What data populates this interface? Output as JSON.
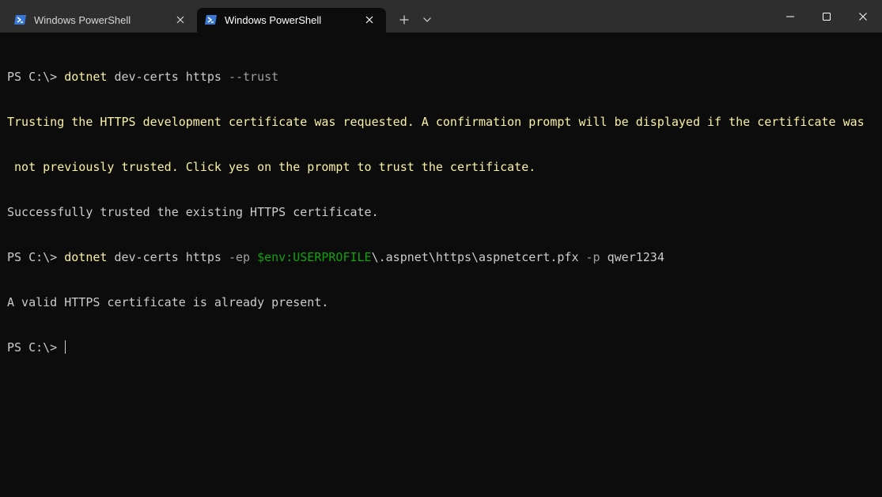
{
  "window": {
    "tabs": [
      {
        "title": "Windows PowerShell",
        "icon": "powershell-icon",
        "active": false
      },
      {
        "title": "Windows PowerShell",
        "icon": "powershell-icon",
        "active": true
      }
    ],
    "new_tab_label": "+",
    "dropdown_icon": "chevron-down-icon",
    "caption_buttons": [
      "minimize-icon",
      "maximize-icon",
      "close-icon"
    ]
  },
  "colors": {
    "titlebar": "#2e2e2e",
    "background": "#0c0c0c",
    "text": "#cccccc",
    "command": "#f9f1a5",
    "parameter": "#9e9e9e",
    "variable": "#13a10e",
    "warning": "#f9f1a5"
  },
  "terminal": {
    "line1": {
      "prompt": "PS C:\\> ",
      "command": "dotnet",
      "args": " dev-certs https ",
      "param": "--trust"
    },
    "line2": "Trusting the HTTPS development certificate was requested. A confirmation prompt will be displayed if the certificate was",
    "line3": " not previously trusted. Click yes on the prompt to trust the certificate.",
    "line4": "Successfully trusted the existing HTTPS certificate.",
    "line5": {
      "prompt": "PS C:\\> ",
      "command": "dotnet",
      "args": " dev-certs https ",
      "param1": "-ep",
      "space1": " ",
      "variable": "$env:USERPROFILE",
      "path": "\\.aspnet\\https\\aspnetcert.pfx ",
      "param2": "-p",
      "value": " qwer1234"
    },
    "line6": "A valid HTTPS certificate is already present.",
    "line7": {
      "prompt": "PS C:\\> "
    }
  }
}
